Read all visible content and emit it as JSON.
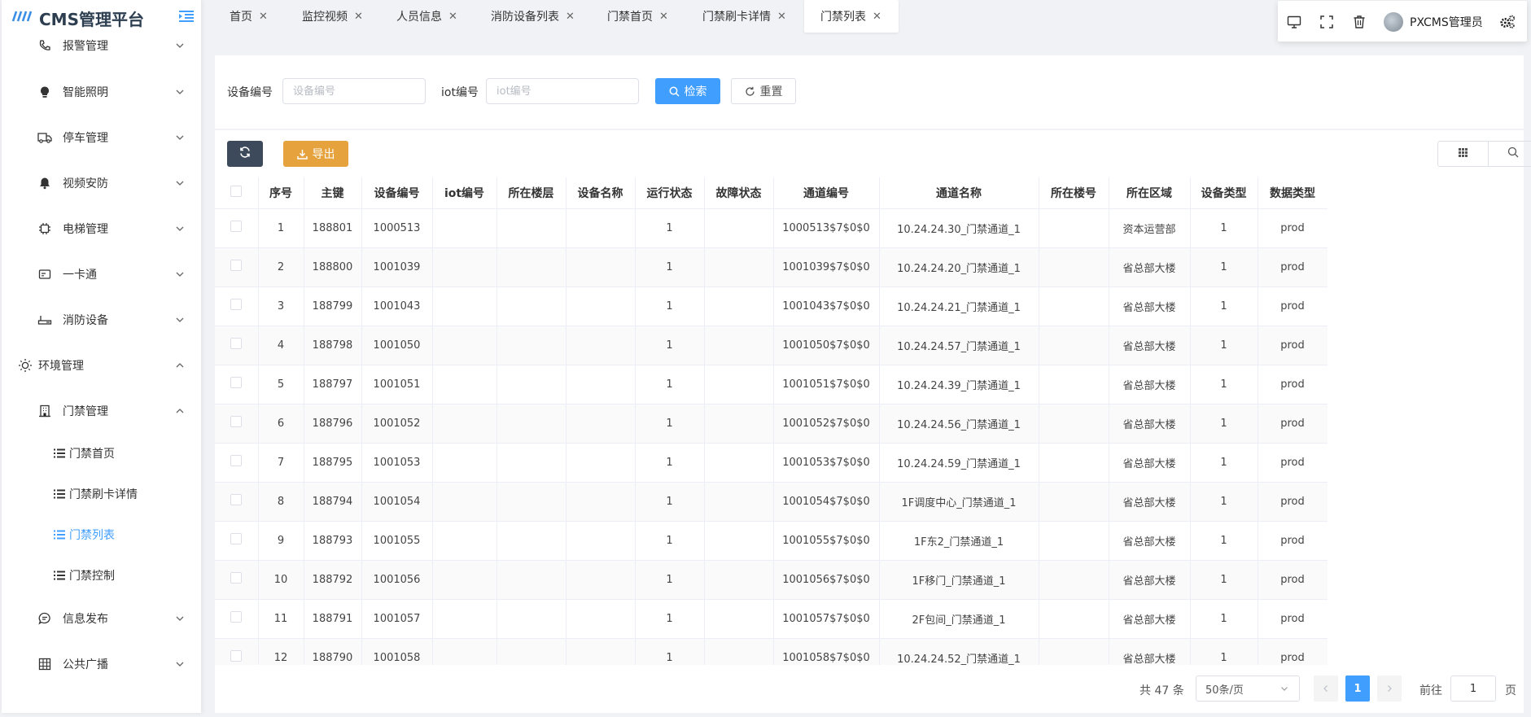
{
  "app": {
    "logo_mark": "",
    "title": "CMS管理平台"
  },
  "tabs": [
    {
      "label": "首页"
    },
    {
      "label": "监控视频"
    },
    {
      "label": "人员信息"
    },
    {
      "label": "消防设备列表"
    },
    {
      "label": "门禁首页"
    },
    {
      "label": "门禁刷卡详情"
    },
    {
      "label": "门禁列表"
    }
  ],
  "topbar": {
    "user_name": "PXCMS管理员"
  },
  "sidebar": {
    "items": [
      {
        "label": "报警管理",
        "icon": "phone-icon"
      },
      {
        "label": "智能照明",
        "icon": "bulb-icon"
      },
      {
        "label": "停车管理",
        "icon": "truck-icon"
      },
      {
        "label": "视频安防",
        "icon": "bell-icon"
      },
      {
        "label": "电梯管理",
        "icon": "chip-icon"
      },
      {
        "label": "一卡通",
        "icon": "card-icon"
      },
      {
        "label": "消防设备",
        "icon": "router-icon"
      },
      {
        "label": "环境管理",
        "icon": "sun-icon"
      },
      {
        "label": "门禁管理",
        "icon": "building-icon"
      },
      {
        "label": "门禁首页",
        "icon": "list-icon"
      },
      {
        "label": "门禁刷卡详情",
        "icon": "list-icon"
      },
      {
        "label": "门禁列表",
        "icon": "list-icon"
      },
      {
        "label": "门禁控制",
        "icon": "list-icon"
      },
      {
        "label": "信息发布",
        "icon": "chat-icon"
      },
      {
        "label": "公共广播",
        "icon": "grid-icon"
      }
    ]
  },
  "search": {
    "device_label": "设备编号",
    "device_placeholder": "设备编号",
    "device_value": "",
    "iot_label": "iot编号",
    "iot_placeholder": "iot编号",
    "iot_value": "",
    "search_button": "检索",
    "reset_button": "重置"
  },
  "toolbar": {
    "export_button": "导出"
  },
  "table": {
    "headers": [
      "序号",
      "主键",
      "设备编号",
      "iot编号",
      "所在楼层",
      "设备名称",
      "运行状态",
      "故障状态",
      "通道编号",
      "通道名称",
      "所在楼号",
      "所在区域",
      "设备类型",
      "数据类型"
    ],
    "rows": [
      [
        "1",
        "188801",
        "1000513",
        "",
        "",
        "",
        "1",
        "",
        "1000513$7$0$0",
        "10.24.24.30_门禁通道_1",
        "",
        "资本运营部",
        "1",
        "prod"
      ],
      [
        "2",
        "188800",
        "1001039",
        "",
        "",
        "",
        "1",
        "",
        "1001039$7$0$0",
        "10.24.24.20_门禁通道_1",
        "",
        "省总部大楼",
        "1",
        "prod"
      ],
      [
        "3",
        "188799",
        "1001043",
        "",
        "",
        "",
        "1",
        "",
        "1001043$7$0$0",
        "10.24.24.21_门禁通道_1",
        "",
        "省总部大楼",
        "1",
        "prod"
      ],
      [
        "4",
        "188798",
        "1001050",
        "",
        "",
        "",
        "1",
        "",
        "1001050$7$0$0",
        "10.24.24.57_门禁通道_1",
        "",
        "省总部大楼",
        "1",
        "prod"
      ],
      [
        "5",
        "188797",
        "1001051",
        "",
        "",
        "",
        "1",
        "",
        "1001051$7$0$0",
        "10.24.24.39_门禁通道_1",
        "",
        "省总部大楼",
        "1",
        "prod"
      ],
      [
        "6",
        "188796",
        "1001052",
        "",
        "",
        "",
        "1",
        "",
        "1001052$7$0$0",
        "10.24.24.56_门禁通道_1",
        "",
        "省总部大楼",
        "1",
        "prod"
      ],
      [
        "7",
        "188795",
        "1001053",
        "",
        "",
        "",
        "1",
        "",
        "1001053$7$0$0",
        "10.24.24.59_门禁通道_1",
        "",
        "省总部大楼",
        "1",
        "prod"
      ],
      [
        "8",
        "188794",
        "1001054",
        "",
        "",
        "",
        "1",
        "",
        "1001054$7$0$0",
        "1F调度中心_门禁通道_1",
        "",
        "省总部大楼",
        "1",
        "prod"
      ],
      [
        "9",
        "188793",
        "1001055",
        "",
        "",
        "",
        "1",
        "",
        "1001055$7$0$0",
        "1F东2_门禁通道_1",
        "",
        "省总部大楼",
        "1",
        "prod"
      ],
      [
        "10",
        "188792",
        "1001056",
        "",
        "",
        "",
        "1",
        "",
        "1001056$7$0$0",
        "1F移门_门禁通道_1",
        "",
        "省总部大楼",
        "1",
        "prod"
      ],
      [
        "11",
        "188791",
        "1001057",
        "",
        "",
        "",
        "1",
        "",
        "1001057$7$0$0",
        "2F包间_门禁通道_1",
        "",
        "省总部大楼",
        "1",
        "prod"
      ],
      [
        "12",
        "188790",
        "1001058",
        "",
        "",
        "",
        "1",
        "",
        "1001058$7$0$0",
        "10.24.24.52_门禁通道_1",
        "",
        "省总部大楼",
        "1",
        "prod"
      ]
    ]
  },
  "pagination": {
    "total_text": "共 47 条",
    "page_size": "50条/页",
    "current_page": "1",
    "goto_label": "前往",
    "goto_value": "1",
    "page_suffix": "页"
  },
  "colors": {
    "primary": "#409eff",
    "warning": "#e6a23c",
    "dark": "#3d4a5c"
  }
}
